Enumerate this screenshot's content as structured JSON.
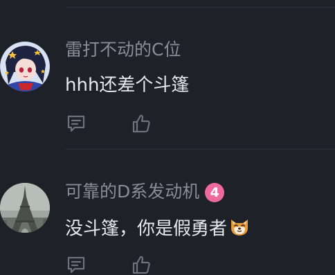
{
  "comments": [
    {
      "username": "雷打不动的C位",
      "text": "hhh还差个斗篷",
      "avatar_icon": "anime-girl-avatar"
    },
    {
      "username": "可靠的D系发动机",
      "level": "4",
      "text": "没斗篷，你是假勇者",
      "avatar_icon": "eiffel-tower-avatar",
      "emoji": "shiba-dog-emoji"
    }
  ],
  "colors": {
    "background": "#1f2129",
    "username": "#8a8d96",
    "text": "#e8e9ee",
    "icon": "#6f727b",
    "level_badge": "#ee6a9c"
  }
}
